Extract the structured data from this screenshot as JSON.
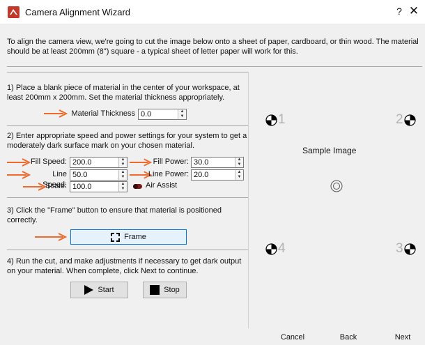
{
  "window": {
    "title": "Camera Alignment Wizard",
    "help_label": "?",
    "close_label": "✕"
  },
  "intro": {
    "text": "To align the camera view, we're going to cut the image below onto a sheet of paper, cardboard, or thin wood. The material should be at least 200mm (8\") square - a typical sheet of letter paper will work for this."
  },
  "step1": {
    "text": "1) Place a blank piece of material in the center of your workspace, at least 200mm x 200mm. Set the material thickness appropriately.",
    "material_thickness_label": "Material Thickness",
    "material_thickness_value": "0.0"
  },
  "step2": {
    "text": "2) Enter appropriate speed and power settings for your system to get a moderately dark surface mark on your chosen material.",
    "fill_speed_label": "Fill Speed:",
    "fill_speed_value": "200.0",
    "fill_power_label": "Fill Power:",
    "fill_power_value": "30.0",
    "line_speed_label": "Line Speed:",
    "line_speed_value": "50.0",
    "line_power_label": "Line Power:",
    "line_power_value": "20.0",
    "scale_label": "Scale:",
    "scale_value": "100.0",
    "air_assist_label": "Air Assist",
    "air_assist_on": false
  },
  "step3": {
    "text": "3) Click the \"Frame\" button to ensure that material is positioned correctly.",
    "frame_label": "Frame"
  },
  "step4": {
    "text": "4) Run the cut, and make adjustments if necessary to get dark output on your material. When complete, click Next to continue.",
    "start_label": "Start",
    "stop_label": "Stop"
  },
  "sample": {
    "label": "Sample Image",
    "marker1": "1",
    "marker2": "2",
    "marker3": "3",
    "marker4": "4"
  },
  "footer": {
    "cancel_label": "Cancel",
    "back_label": "Back",
    "next_label": "Next"
  },
  "colors": {
    "arrow": "#ef6a2c",
    "accent_border": "#0078d7",
    "frame_bg": "#e5f1fb"
  },
  "icons": {
    "app": "lightburn-app-icon",
    "play": "play-icon",
    "stop": "stop-icon",
    "frame": "frame-icon",
    "registration": "registration-mark-icon"
  }
}
